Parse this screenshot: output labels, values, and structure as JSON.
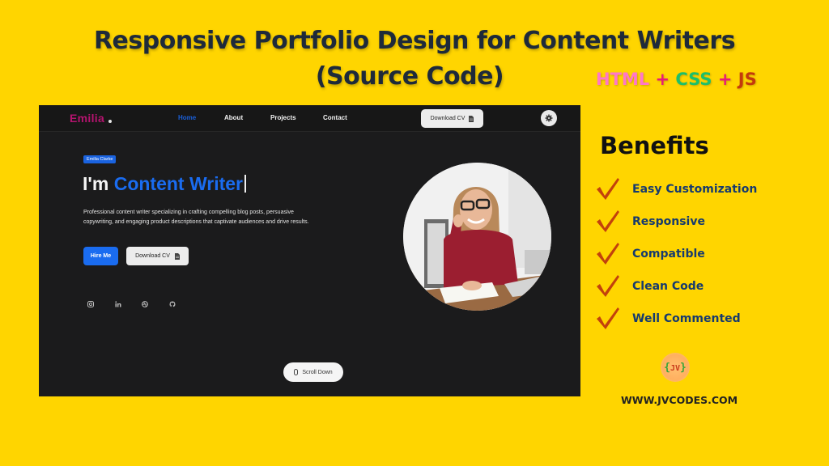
{
  "banner": {
    "title_line1": "Responsive Portfolio Design for Content Writers",
    "title_line2": "(Source Code)",
    "tech": {
      "html": "HTML",
      "plus1": "+",
      "css": "CSS",
      "plus2": "+",
      "js": "JS"
    }
  },
  "portfolio": {
    "nav": {
      "logo": "Emilia",
      "links": [
        "Home",
        "About",
        "Projects",
        "Contact"
      ],
      "active_link": "Home",
      "download_cv": "Download CV",
      "theme_toggle_icon": "gear-icon"
    },
    "hero": {
      "badge": "Emilia Clarke",
      "headline_prefix": "I'm",
      "headline_highlight": "Content Writer",
      "description": "Professional content writer specializing in crafting compelling blog posts, persuasive copywriting, and engaging product descriptions that captivate audiences and drive results.",
      "hire_button": "Hire Me",
      "download_button": "Download CV",
      "socials": [
        "instagram-icon",
        "linkedin-icon",
        "dribbble-icon",
        "github-icon"
      ],
      "scroll_label": "Scroll Down"
    },
    "colors": {
      "accent": "#1a6cf0",
      "logo": "#b5136f",
      "background": "#1b1b1c"
    }
  },
  "benefits": {
    "title": "Benefits",
    "items": [
      "Easy Customization",
      "Responsive",
      "Compatible",
      "Clean Code",
      "Well Commented"
    ]
  },
  "branding": {
    "logo_text": "JV",
    "url": "WWW.JVCODES.COM"
  },
  "colors": {
    "page_background": "#FFD500",
    "title": "#1e2a3a",
    "benefit_text": "#163a6e",
    "check": "#c2410c"
  }
}
